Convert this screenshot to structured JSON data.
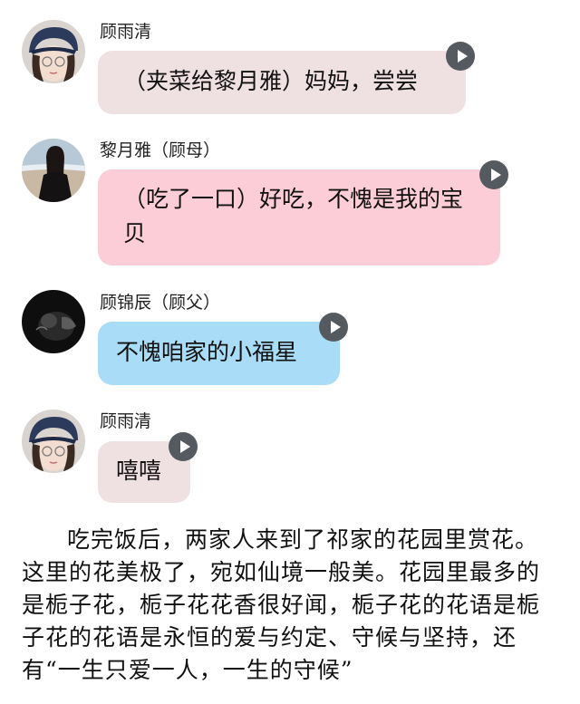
{
  "messages": [
    {
      "speaker": "顾雨清",
      "text": "（夹菜给黎月雅）妈妈，尝尝",
      "bubble_color": "#efe0e2",
      "avatar": "girl-cap-avatar"
    },
    {
      "speaker": "黎月雅（顾母）",
      "text": "（吃了一口）好吃，不愧是我的宝贝",
      "bubble_color": "#fdcdd7",
      "avatar": "woman-beach-avatar"
    },
    {
      "speaker": "顾锦辰（顾父）",
      "text": "不愧咱家的小福星",
      "bubble_color": "#a9dcf6",
      "avatar": "dark-cat-avatar"
    },
    {
      "speaker": "顾雨清",
      "text": "嘻嘻",
      "bubble_color": "#efe0e2",
      "avatar": "girl-cap-avatar"
    }
  ],
  "narration": "吃完饭后，两家人来到了祁家的花园里赏花。这里的花美极了，宛如仙境一般美。花园里最多的是栀子花，栀子花花香很好闻，栀子花的花语是栀子花的花语是永恒的爱与约定、守候与坚持，还有“一生只爱一人，一生的守候”"
}
